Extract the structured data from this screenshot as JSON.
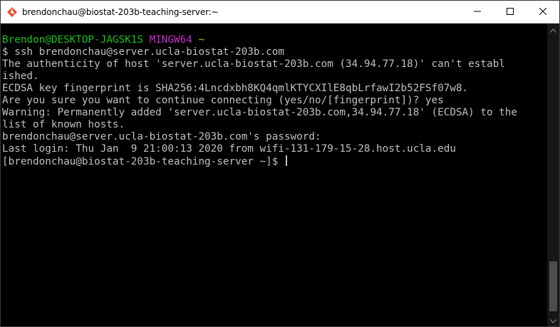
{
  "window": {
    "title": "brendonchau@biostat-203b-teaching-server:~",
    "app_icon": "mintty-terminal-icon",
    "controls": {
      "minimize": "minimize-icon",
      "maximize": "maximize-icon",
      "close": "close-icon"
    }
  },
  "terminal": {
    "colors": {
      "background": "#000000",
      "text": "#c0c0c0",
      "user_host": "#18c018",
      "shell": "#c030c0",
      "path": "#c0c000"
    },
    "prompt": {
      "user_host": "Brendon@DESKTOP-JAGSK1S",
      "shell": "MINGW64",
      "path": "~"
    },
    "lines": [
      "$ ssh brendonchau@server.ucla-biostat-203b.com",
      "The authenticity of host 'server.ucla-biostat-203b.com (34.94.77.18)' can't establ",
      "ished.",
      "ECDSA key fingerprint is SHA256:4Lncdxbh8KQ4qmlKTYCXIlE8qbLrfawI2b52FSf07w8.",
      "Are you sure you want to continue connecting (yes/no/[fingerprint])? yes",
      "Warning: Permanently added 'server.ucla-biostat-203b.com,34.94.77.18' (ECDSA) to the",
      "list of known hosts.",
      "brendonchau@server.ucla-biostat-203b.com's password:",
      "Last login: Thu Jan  9 21:00:13 2020 from wifi-131-179-15-28.host.ucla.edu"
    ],
    "remote_prompt": "[brendonchau@biostat-203b-teaching-server ~]$ "
  }
}
